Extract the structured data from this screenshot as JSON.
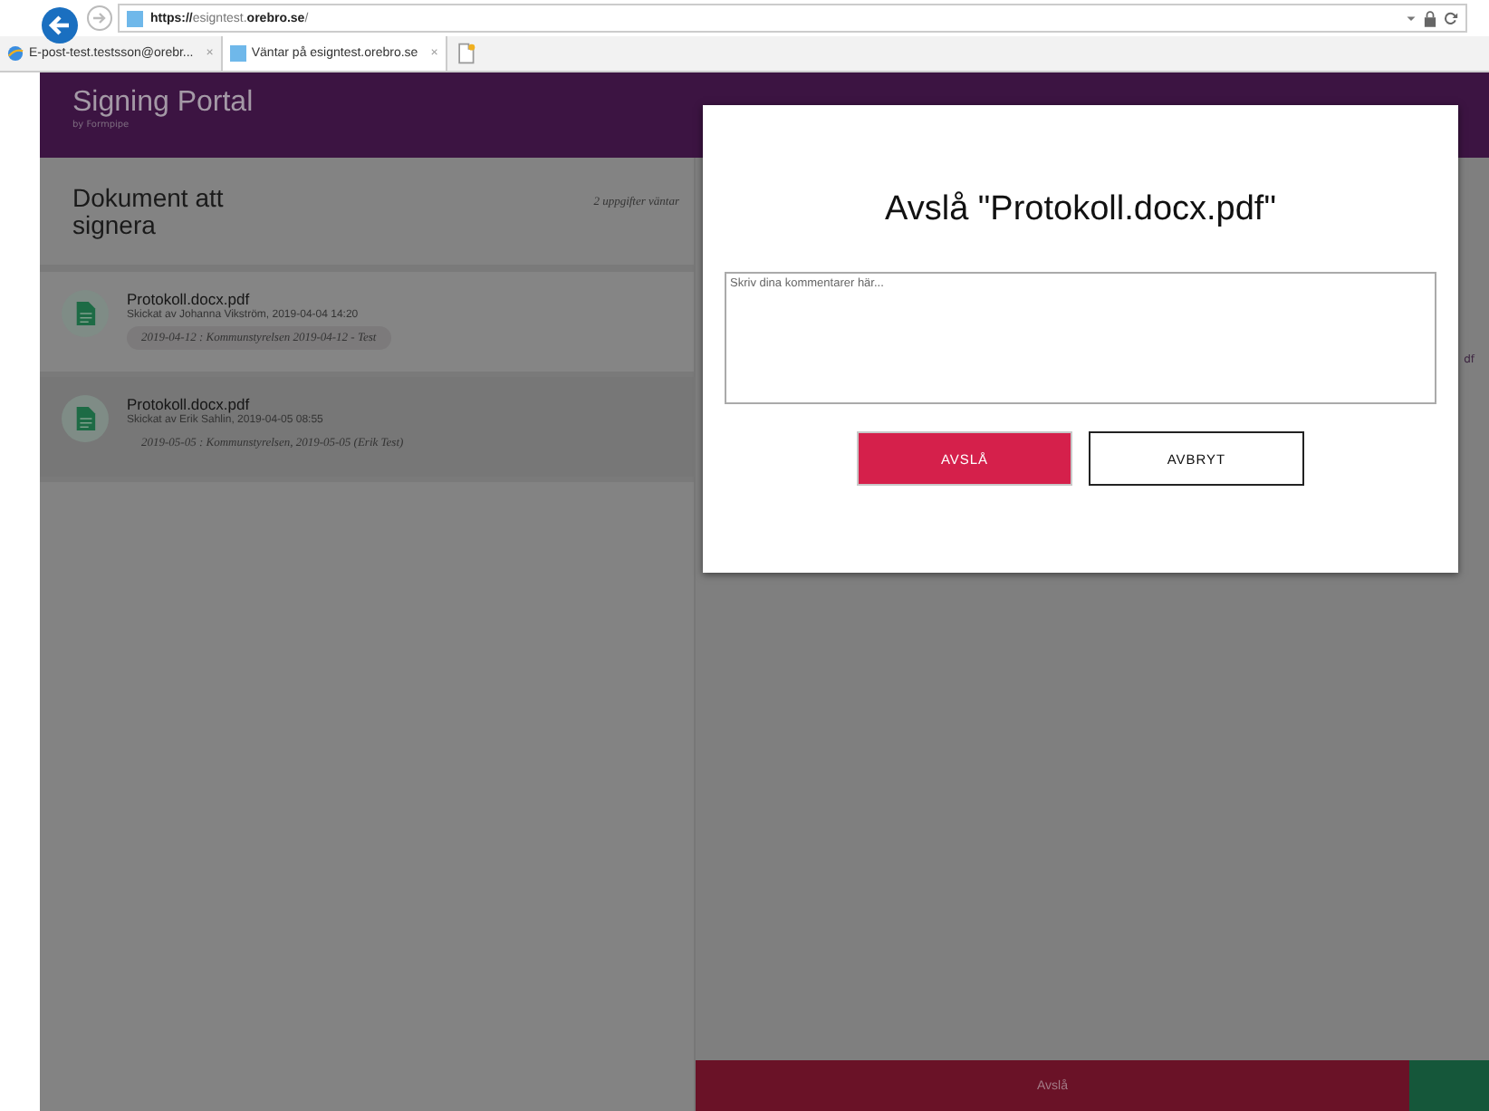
{
  "browser": {
    "url_prefix": "https://",
    "url_host": "esigntest.",
    "url_domain": "orebro.se",
    "url_suffix": "/",
    "tabs": [
      {
        "title": "E-post-test.testsson@orebr...",
        "close": "×",
        "selected": false
      },
      {
        "title": "Väntar på esigntest.orebro.se",
        "close": "×",
        "selected": true
      }
    ]
  },
  "header": {
    "title": "Signing Portal",
    "subtitle": "by Formpipe"
  },
  "documents": {
    "title": "Dokument att signera",
    "count": "2 uppgifter väntar",
    "items": [
      {
        "name": "Protokoll.docx.pdf",
        "sent": "Skickat av Johanna Vikström, 2019-04-04 14:20",
        "tag": "2019-04-12 : Kommunstyrelsen 2019-04-12 - Test",
        "selected": false
      },
      {
        "name": "Protokoll.docx.pdf",
        "sent": "Skickat av Erik Sahlin, 2019-04-05 08:55",
        "tag": "2019-05-05 : Kommunstyrelsen, 2019-05-05 (Erik Test)",
        "selected": true
      }
    ]
  },
  "detail": {
    "text_fragment": "df",
    "reject_button": "Avslå"
  },
  "dialog": {
    "title": "Avslå \"Protokoll.docx.pdf\"",
    "comment": {
      "placeholder": "Skriv dina kommentarer här..."
    },
    "confirm_button": "AVSLÅ",
    "cancel_button": "AVBRYT"
  }
}
